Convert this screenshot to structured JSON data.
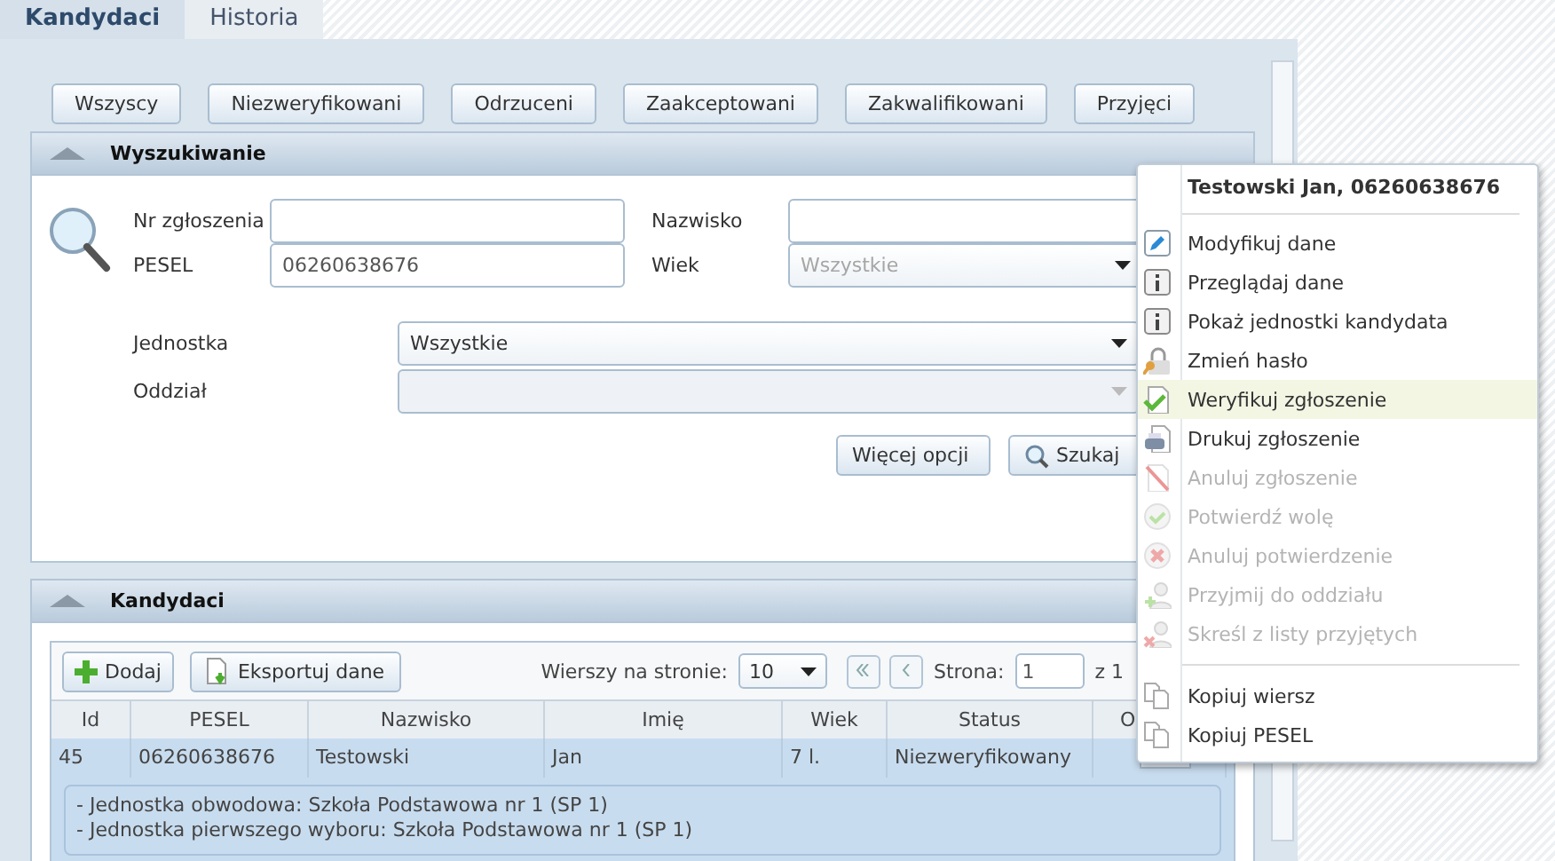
{
  "tabs": [
    {
      "label": "Kandydaci",
      "selected": true
    },
    {
      "label": "Historia",
      "selected": false
    }
  ],
  "filter_buttons": [
    "Wszyscy",
    "Niezweryfikowani",
    "Odrzuceni",
    "Zaakceptowani",
    "Zakwalifikowani",
    "Przyjęci"
  ],
  "search_panel": {
    "title": "Wyszukiwanie",
    "expanded": true,
    "fields": [
      {
        "label": "Nr zgłoszenia"
      },
      {
        "label": "PESEL",
        "value": "06260638676"
      }
    ],
    "fields_right": [
      {
        "label": "Nazwisko",
        "kind": "input"
      },
      {
        "label": "Wiek",
        "kind": "select",
        "placeholder": "Wszystkie"
      }
    ],
    "selects": [
      {
        "label": "Jednostka",
        "value": "Wszystkie",
        "disabled": false
      },
      {
        "label": "Oddział",
        "disabled": true
      }
    ],
    "buttons": [
      "Więcej opcji",
      "Szukaj"
    ]
  },
  "candidates_panel": {
    "title": "Kandydaci",
    "expanded": true,
    "toolbar": {
      "add": "Dodaj",
      "export": "Eksportuj dane",
      "rows_label": "Wierszy na stronie:",
      "rows_value": "10",
      "page_label": "Strona:",
      "page_value": "1",
      "page_total": "z 1"
    },
    "columns": [
      "Id",
      "PESEL",
      "Nazwisko",
      "Imię",
      "Wiek",
      "Status",
      "O"
    ],
    "rows": [
      {
        "cells": [
          "45",
          "06260638676",
          "Testowski",
          "Jan",
          "7 l.",
          "Niezweryfikowany"
        ],
        "selected": true,
        "details": [
          "- Jednostka obwodowa: Szkoła Podstawowa nr 1 (SP 1)",
          "- Jednostka pierwszego wyboru: Szkoła Podstawowa nr 1 (SP 1)"
        ]
      }
    ]
  },
  "context_menu": {
    "title": "Testowski Jan, 06260638676",
    "sections": [
      [
        {
          "label": "Modyfikuj dane",
          "disabled": false,
          "highlighted": false
        },
        {
          "label": "Przeglądaj dane",
          "disabled": false,
          "highlighted": false
        },
        {
          "label": "Pokaż jednostki kandydata",
          "disabled": false,
          "highlighted": false
        },
        {
          "label": "Zmień hasło",
          "disabled": false,
          "highlighted": false
        },
        {
          "label": "Weryfikuj zgłoszenie",
          "disabled": false,
          "highlighted": true
        },
        {
          "label": "Drukuj zgłoszenie",
          "disabled": false,
          "highlighted": false
        },
        {
          "label": "Anuluj zgłoszenie",
          "disabled": true,
          "highlighted": false
        },
        {
          "label": "Potwierdź wolę",
          "disabled": true,
          "highlighted": false
        },
        {
          "label": "Anuluj potwierdzenie",
          "disabled": true,
          "highlighted": false
        },
        {
          "label": "Przyjmij do oddziału",
          "disabled": true,
          "highlighted": false
        },
        {
          "label": "Skreśl z listy przyjętych",
          "disabled": true,
          "highlighted": false
        }
      ],
      [
        {
          "label": "Kopiuj wiersz",
          "disabled": false,
          "highlighted": false
        },
        {
          "label": "Kopiuj PESEL",
          "disabled": false,
          "highlighted": false
        }
      ]
    ]
  }
}
